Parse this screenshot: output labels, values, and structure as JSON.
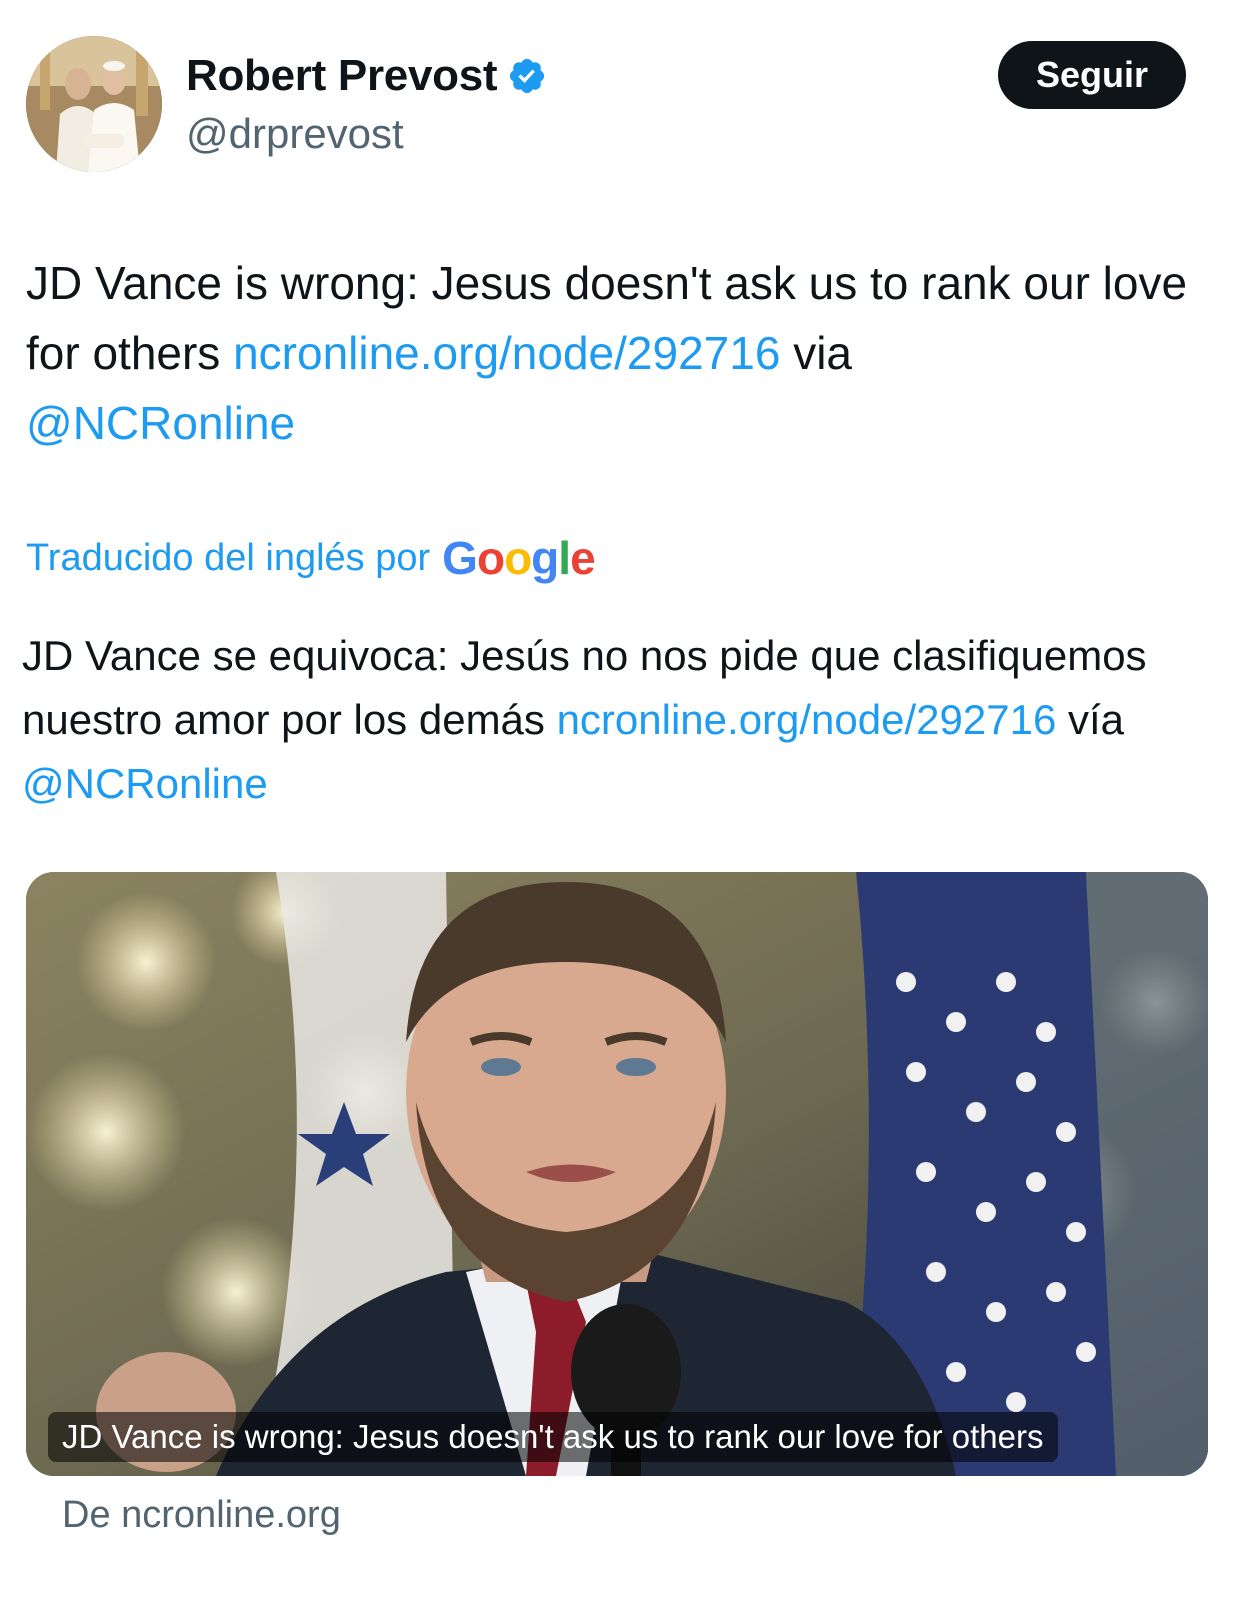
{
  "user": {
    "display_name": "Robert Prevost",
    "handle": "@drprevost",
    "verified": true
  },
  "follow_button": {
    "label": "Seguir"
  },
  "tweet": {
    "text_before_link": "JD Vance is wrong: Jesus doesn't ask us to rank our love for others ",
    "link": "ncronline.org/node/292716",
    "text_after_link": " via ",
    "mention": "@NCRonline"
  },
  "translation": {
    "label": "Traducido del inglés por",
    "provider": "Google",
    "text_before_link": "JD Vance se equivoca: Jesús no nos pide que clasifiquemos nuestro amor por los demás ",
    "link": "ncronline.org/node/292716",
    "text_after_link": " vía ",
    "mention": "@NCRonline"
  },
  "card": {
    "caption": "JD Vance is wrong: Jesus doesn't ask us to rank our love for others",
    "domain": "De ncronline.org"
  },
  "colors": {
    "link": "#1d9bf0",
    "text": "#0f1419",
    "secondary": "#536471",
    "button_bg": "#0f1419"
  },
  "icons": {
    "verified": "verified-badge-icon"
  }
}
